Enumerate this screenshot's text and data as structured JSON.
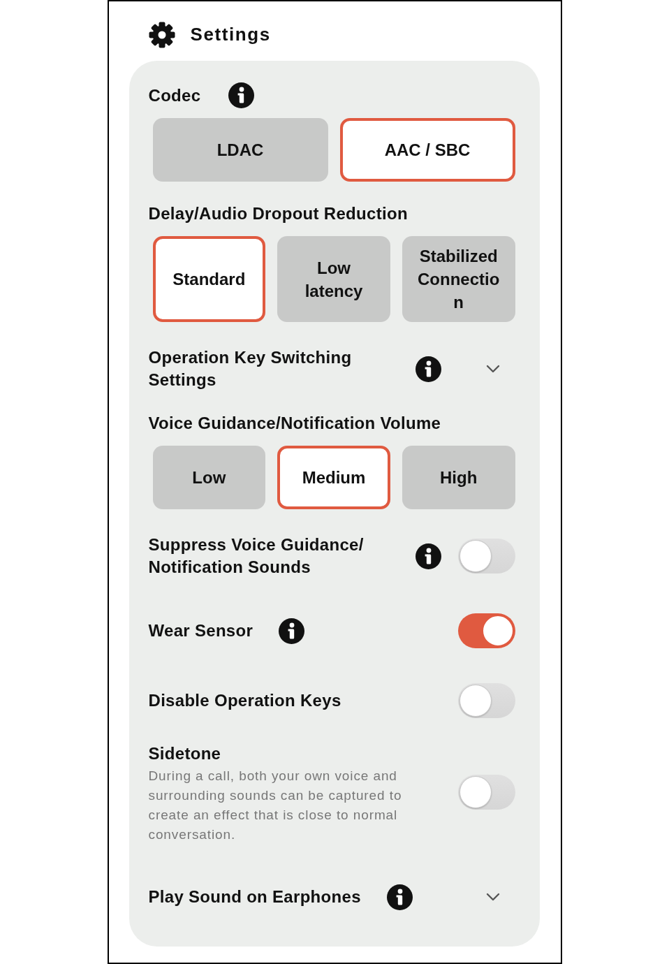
{
  "header": {
    "title": "Settings"
  },
  "sections": [
    {
      "kind": "segmented",
      "label": "Codec",
      "info": true,
      "options": [
        {
          "label": "LDAC",
          "selected": false
        },
        {
          "label": "AAC / SBC",
          "selected": true
        }
      ]
    },
    {
      "kind": "segmented",
      "label": "Delay/Audio Dropout Reduction",
      "info": false,
      "options": [
        {
          "label": "Standard",
          "selected": true
        },
        {
          "label": "Low latency",
          "selected": false
        },
        {
          "label": "Stabilized Connection",
          "selected": false
        }
      ]
    },
    {
      "kind": "expander",
      "label": "Operation Key Switching Settings",
      "info": true,
      "expanded": false
    },
    {
      "kind": "segmented",
      "label": "Voice Guidance/Notification Volume",
      "info": false,
      "options": [
        {
          "label": "Low",
          "selected": false
        },
        {
          "label": "Medium",
          "selected": true
        },
        {
          "label": "High",
          "selected": false
        }
      ]
    },
    {
      "kind": "toggle",
      "label": "Suppress Voice Guidance/Notification Sounds",
      "info": true,
      "on": false
    },
    {
      "kind": "toggle",
      "label": "Wear Sensor",
      "info": true,
      "on": true
    },
    {
      "kind": "toggle",
      "label": "Disable Operation Keys",
      "info": false,
      "on": false
    },
    {
      "kind": "toggle",
      "label": "Sidetone",
      "info": false,
      "on": false,
      "description": "During a call, both your own voice and surrounding sounds can be captured to create an effect that is close to normal conversation."
    },
    {
      "kind": "expander",
      "label": "Play Sound on Earphones",
      "info": true,
      "expanded": false
    }
  ]
}
